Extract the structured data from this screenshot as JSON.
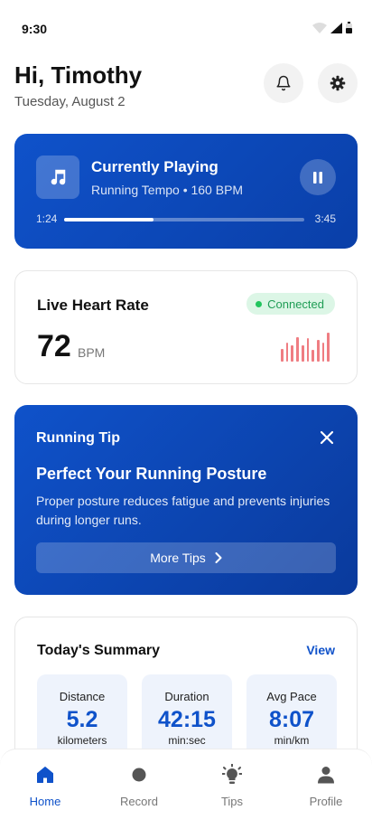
{
  "status_bar": {
    "time": "9:30"
  },
  "header": {
    "greeting": "Hi, Timothy",
    "date": "Tuesday, August 2"
  },
  "player": {
    "title": "Currently Playing",
    "subtitle": "Running Tempo • 160 BPM",
    "current_time": "1:24",
    "total_time": "3:45",
    "progress_fraction": 0.373
  },
  "heart_rate": {
    "title": "Live Heart Rate",
    "status": "Connected",
    "value": "72",
    "unit": "BPM",
    "bars": [
      0.45,
      0.65,
      0.55,
      0.85,
      0.55,
      0.8,
      0.4,
      0.75,
      0.65,
      1.0
    ]
  },
  "tip": {
    "label": "Running Tip",
    "title": "Perfect Your Running Posture",
    "body": "Proper posture reduces fatigue and prevents injuries during longer runs.",
    "button": "More Tips"
  },
  "summary": {
    "title": "Today's Summary",
    "view_label": "View",
    "stats": [
      {
        "label": "Distance",
        "value": "5.2",
        "unit": "kilometers"
      },
      {
        "label": "Duration",
        "value": "42:15",
        "unit": "min:sec"
      },
      {
        "label": "Avg Pace",
        "value": "8:07",
        "unit": "min/km"
      }
    ]
  },
  "nav": {
    "items": [
      {
        "label": "Home",
        "icon": "home-icon"
      },
      {
        "label": "Record",
        "icon": "record-icon"
      },
      {
        "label": "Tips",
        "icon": "lightbulb-icon"
      },
      {
        "label": "Profile",
        "icon": "profile-icon"
      }
    ],
    "active": "Home"
  },
  "colors": {
    "accent": "#0f52ca",
    "connected": "#22c55e",
    "heart_bars": "#ef7d82"
  }
}
